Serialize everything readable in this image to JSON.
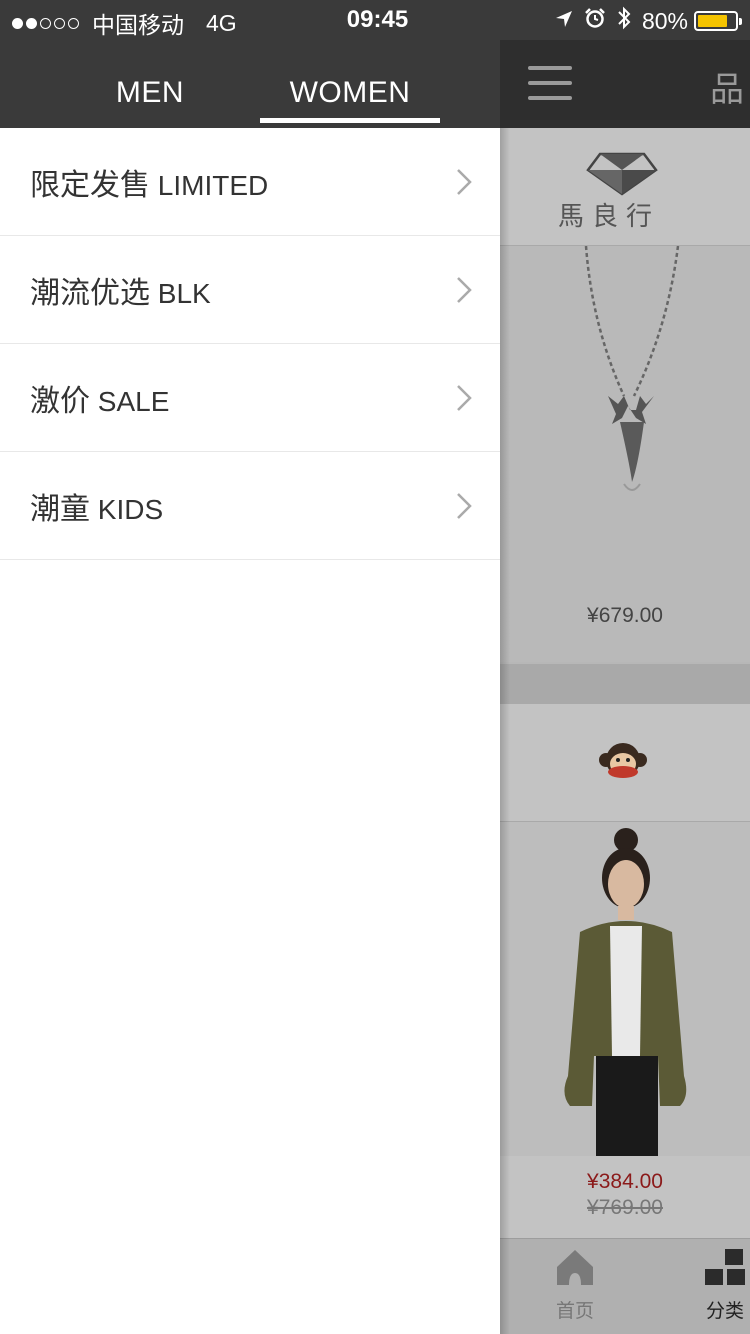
{
  "status_bar": {
    "carrier": "中国移动",
    "network": "4G",
    "time": "09:45",
    "battery": "80%",
    "battery_level": 0.8,
    "signal_bars_filled": 2,
    "signal_bars_total": 5,
    "icons": [
      "location-arrow-icon",
      "alarm-icon",
      "bluetooth-icon",
      "battery-icon"
    ],
    "battery_color": "#f5c400"
  },
  "drawer": {
    "tabs": [
      {
        "label": "MEN",
        "active": false
      },
      {
        "label": "WOMEN",
        "active": true
      }
    ],
    "menu_items": [
      {
        "zh": "限定发售",
        "en": "LIMITED"
      },
      {
        "zh": "潮流优选",
        "en": "BLK"
      },
      {
        "zh": "激价",
        "en": "SALE"
      },
      {
        "zh": "潮童",
        "en": "KIDS"
      }
    ],
    "chevron_icon": "chevron-right-icon"
  },
  "background_page": {
    "title": "品",
    "menu_icon": "hamburger-icon",
    "brands": [
      {
        "name": "馬良行",
        "logo": "diamond-logo"
      },
      {
        "name": "",
        "logo": "monkey-logo"
      }
    ],
    "products": [
      {
        "price": "¥679.00",
        "image": "deer-necklace"
      },
      {
        "sale_price": "¥384.00",
        "original_price": "¥769.00",
        "image": "green-jacket-model"
      }
    ],
    "tabbar": [
      {
        "label": "首页",
        "icon": "home-icon"
      },
      {
        "label": "分类",
        "icon": "category-icon"
      }
    ],
    "sale_color": "#8b1a1a"
  }
}
